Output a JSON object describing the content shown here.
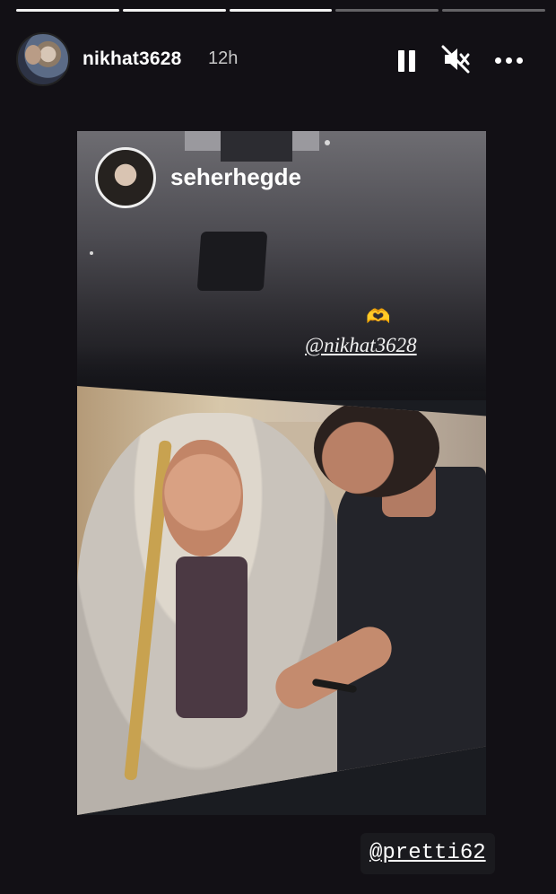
{
  "story": {
    "progress_segments": 5,
    "progress_completed": 3,
    "author": {
      "username": "nikhat3628",
      "time_ago": "12h"
    },
    "controls": {
      "pause": "pause-icon",
      "mute": "muted-speaker-icon",
      "more": "more-dots-icon"
    }
  },
  "photo": {
    "reposted_from": "seherhegde",
    "emoji": "🫶",
    "mention_top": "@nikhat3628"
  },
  "mention_bottom": "@pretti62"
}
